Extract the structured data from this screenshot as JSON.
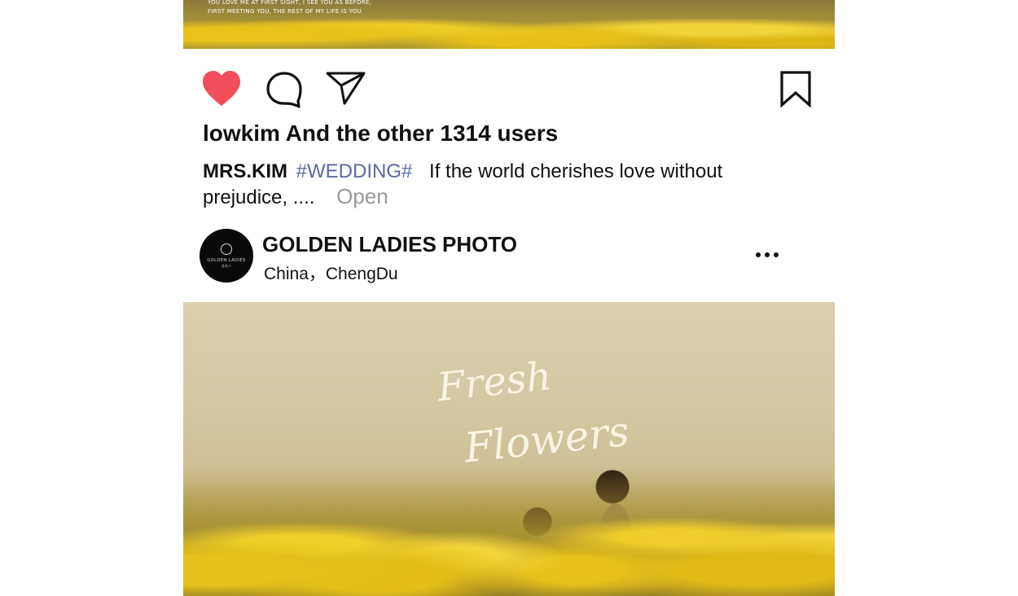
{
  "top_photo": {
    "caption_line1": "YOU LOVE ME AT FIRST SIGHT, I SEE YOU AS BEFORE,",
    "caption_line2": "FIRST MEETING YOU, THE REST OF MY LIFE IS YOU"
  },
  "actions": {
    "like_icon": "heart-icon",
    "comment_icon": "comment-icon",
    "share_icon": "send-icon",
    "save_icon": "bookmark-icon",
    "like_color": "#f24d5a"
  },
  "likes_text": "lowkim And the other 1314 users",
  "caption": {
    "author": "MRS.KIM",
    "hashtag": "#WEDDING#",
    "text": "If the world cherishes love without prejudice, ....",
    "more_label": "Open"
  },
  "account": {
    "name": "GOLDEN LADIES PHOTO",
    "location": "China，ChengDu",
    "avatar_text": "GOLDEN LADIES",
    "avatar_subtext": "金夫人",
    "menu_icon": "more-options-icon"
  },
  "photo": {
    "script_line1": "Fresh",
    "script_line2": "Flowers"
  }
}
